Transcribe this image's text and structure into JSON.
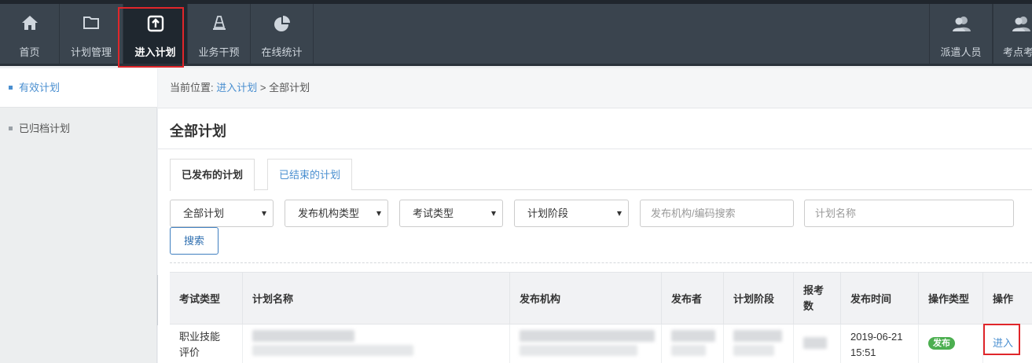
{
  "nav": {
    "items": [
      {
        "label": "首页",
        "icon": "home-icon"
      },
      {
        "label": "计划管理",
        "icon": "folder-icon"
      },
      {
        "label": "进入计划",
        "icon": "enter-plan-icon"
      },
      {
        "label": "业务干预",
        "icon": "cone-icon"
      },
      {
        "label": "在线统计",
        "icon": "pie-chart-icon"
      }
    ],
    "right_items": [
      {
        "label": "派遣人员",
        "icon": "users-icon"
      },
      {
        "label": "考点考",
        "icon": "users-icon"
      }
    ]
  },
  "sidebar": {
    "items": [
      {
        "label": "有效计划"
      },
      {
        "label": "已归档计划"
      }
    ]
  },
  "breadcrumb": {
    "prefix": "当前位置:",
    "link": "进入计划",
    "sep": ">",
    "current": "全部计划"
  },
  "page_title": "全部计划",
  "tabs": [
    {
      "label": "已发布的计划"
    },
    {
      "label": "已结束的计划"
    }
  ],
  "filters": {
    "selects": [
      "全部计划",
      "发布机构类型",
      "考试类型",
      "计划阶段"
    ],
    "org_search_placeholder": "发布机构/编码搜索",
    "plan_name_placeholder": "计划名称",
    "search_label": "搜索"
  },
  "table": {
    "headers": [
      "考试类型",
      "计划名称",
      "发布机构",
      "发布者",
      "计划阶段",
      "报考数",
      "发布时间",
      "操作类型",
      "操作"
    ],
    "rows": [
      {
        "exam_type": "职业技能评价",
        "publish_date": "2019-06-21",
        "publish_time": "15:51",
        "op_type": "发布",
        "action": "进入"
      }
    ]
  },
  "colors": {
    "accent": "#4a8fd0",
    "nav_bg": "#3a444e",
    "highlight": "#e0262a",
    "badge": "#4caf50"
  }
}
